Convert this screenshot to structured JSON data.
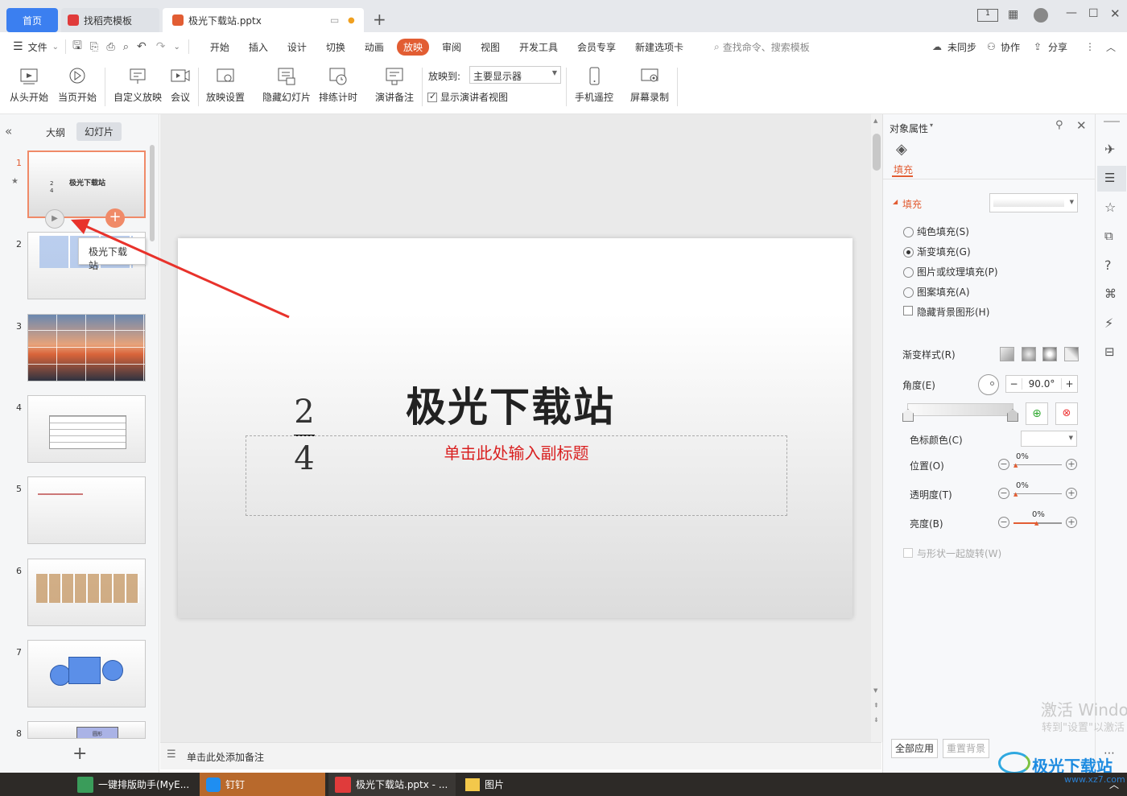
{
  "tabs": {
    "home": "首页",
    "template": "找稻壳模板",
    "file": "极光下载站.pptx"
  },
  "menu": {
    "file": "文件",
    "items": [
      "开始",
      "插入",
      "设计",
      "切换",
      "动画",
      "放映",
      "审阅",
      "视图",
      "开发工具",
      "会员专享",
      "新建选项卡"
    ],
    "active": "放映",
    "search": "查找命令、搜索模板",
    "sync": "未同步",
    "collab": "协作",
    "share": "分享"
  },
  "ribbon": {
    "from_start": "从头开始",
    "from_current": "当页开始",
    "custom": "自定义放映",
    "meeting": "会议",
    "settings": "放映设置",
    "hide": "隐藏幻灯片",
    "rehearse": "排练计时",
    "notes": "演讲备注",
    "play_to_label": "放映到:",
    "play_to_value": "主要显示器",
    "presenter_view": "显示演讲者视图",
    "remote": "手机遥控",
    "record": "屏幕录制"
  },
  "left": {
    "outline": "大纲",
    "slides": "幻灯片",
    "tooltip": "极光下载站",
    "thumb1_title": "极光下载站",
    "thumb7_label": "圆形"
  },
  "slide": {
    "title": "极光下载站",
    "numerator": "2",
    "denominator": "4",
    "subtitle": "单击此处输入副标题"
  },
  "notes": {
    "placeholder": "单击此处添加备注"
  },
  "props": {
    "header": "对象属性",
    "tab": "填充",
    "section": "填充",
    "options": [
      "纯色填充(S)",
      "渐变填充(G)",
      "图片或纹理填充(P)",
      "图案填充(A)"
    ],
    "selected": "渐变填充(G)",
    "hide_bg": "隐藏背景图形(H)",
    "gradient_style": "渐变样式(R)",
    "angle_label": "角度(E)",
    "angle_value": "90.0°",
    "stop_color": "色标颜色(C)",
    "position": "位置(O)",
    "transparency": "透明度(T)",
    "brightness": "亮度(B)",
    "position_value": "0%",
    "transparency_value": "0%",
    "brightness_value": "0%",
    "rotate_with_shape": "与形状一起旋转(W)",
    "apply_all": "全部应用",
    "reset_bg": "重置背景"
  },
  "watermark": {
    "line1": "激活 Windo",
    "line2": "转到\"设置\"以激活",
    "logo": "极光下载站",
    "url": "www.xz7.com"
  },
  "taskbar": {
    "items": [
      "一键排版助手(MyE...",
      "钉钉",
      "极光下载站.pptx - ...",
      "图片"
    ]
  },
  "colors": {
    "accent": "#e25d33",
    "tab_blue": "#3b7ff0",
    "arrow": "#e8322b",
    "subtitle": "#d92020"
  }
}
